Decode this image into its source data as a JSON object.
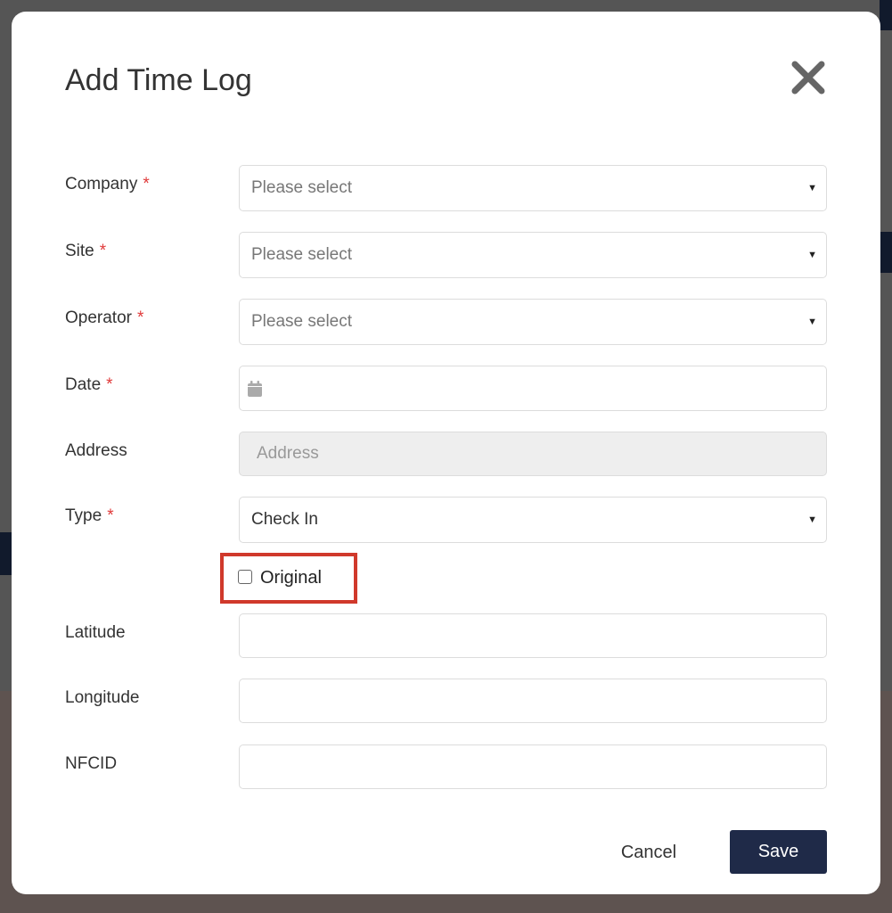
{
  "dialog": {
    "title": "Add Time Log",
    "close_icon": "close-icon",
    "fields": {
      "company": {
        "label": "Company",
        "required": "*",
        "value": "Please select"
      },
      "site": {
        "label": "Site",
        "required": "*",
        "value": "Please select"
      },
      "operator": {
        "label": "Operator",
        "required": "*",
        "value": "Please select"
      },
      "date": {
        "label": "Date",
        "required": "*",
        "value": "",
        "icon": "calendar-icon"
      },
      "address": {
        "label": "Address",
        "placeholder": "Address"
      },
      "type": {
        "label": "Type",
        "required": "*",
        "value": "Check In"
      },
      "original": {
        "label": "Original",
        "checked": false
      },
      "latitude": {
        "label": "Latitude",
        "value": ""
      },
      "longitude": {
        "label": "Longitude",
        "value": ""
      },
      "nfcid": {
        "label": "NFCID",
        "value": ""
      }
    },
    "cancel_label": "Cancel",
    "save_label": "Save",
    "highlight_color": "#d0392b",
    "primary_color": "#1f2a48"
  }
}
